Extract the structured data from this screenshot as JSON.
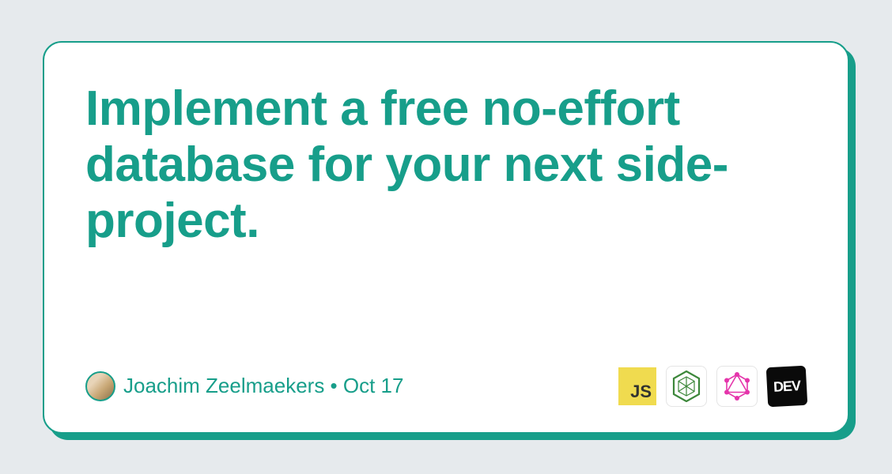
{
  "card": {
    "title": "Implement a free no-effort database for your next side-project.",
    "author": "Joachim Zeelmaekers",
    "separator": "•",
    "date": "Oct 17"
  },
  "tags": {
    "js": "JS",
    "dev": "DEV"
  }
}
